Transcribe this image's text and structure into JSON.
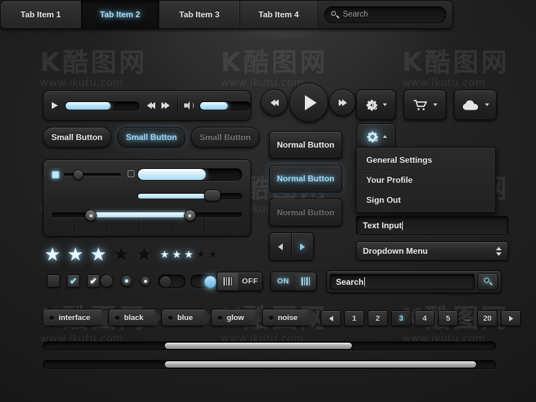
{
  "watermark": {
    "glyphs": "K酷图网",
    "url": "www.ikutu.com"
  },
  "tabbar": {
    "tabs": [
      {
        "label": "Tab Item 1",
        "active": false
      },
      {
        "label": "Tab Item 2",
        "active": true
      },
      {
        "label": "Tab Item 3",
        "active": false
      },
      {
        "label": "Tab Item 4",
        "active": false
      }
    ],
    "search_placeholder": "Search",
    "search_icon": "search-icon"
  },
  "player": {
    "play_icon": "play-icon",
    "progress_percent": 62,
    "prev_icon": "rewind-icon",
    "next_icon": "fast-forward-icon",
    "volume_icon": "speaker-icon",
    "volume_percent": 55
  },
  "transport": {
    "prev_icon": "rewind-icon",
    "play_icon": "play-icon",
    "next_icon": "fast-forward-icon"
  },
  "icon_buttons": [
    {
      "icon": "gear-icon",
      "name": "settings-dropdown-button"
    },
    {
      "icon": "cart-icon",
      "name": "cart-dropdown-button"
    },
    {
      "icon": "cloud-icon",
      "name": "cloud-dropdown-button"
    }
  ],
  "small_buttons": [
    {
      "label": "Small Button",
      "state": "default"
    },
    {
      "label": "Small Button",
      "state": "active"
    },
    {
      "label": "Small Button",
      "state": "disabled"
    }
  ],
  "normal_buttons": [
    {
      "label": "Normal Button",
      "state": "default"
    },
    {
      "label": "Normal Button",
      "state": "active"
    },
    {
      "label": "Normal Button",
      "state": "disabled"
    }
  ],
  "gear_menu": {
    "icon": "gear-icon",
    "items": [
      "General Settings",
      "Your Profile",
      "Sign Out"
    ]
  },
  "sliders": {
    "mini_value_percent": 16,
    "progress_value_percent": 65,
    "thin_value_percent": 72,
    "range_low_percent": 20,
    "range_high_percent": 72
  },
  "segmented": {
    "prev_icon": "left-arrow-icon",
    "next_icon": "right-arrow-icon",
    "active": "next"
  },
  "text_input": {
    "value": "Text Input"
  },
  "dropdown": {
    "value": "Dropdown Menu",
    "icon": "up-down-chevron-icon"
  },
  "stars": {
    "large": {
      "filled": 3,
      "total": 5,
      "glyph": "★"
    },
    "small": {
      "filled": 3,
      "total": 5,
      "glyph": "★"
    }
  },
  "checkboxes": [
    {
      "state": "unchecked",
      "mark": ""
    },
    {
      "state": "checked-blue",
      "mark": "✔"
    },
    {
      "state": "checked-white",
      "mark": "✔"
    }
  ],
  "radios": [
    {
      "state": "empty"
    },
    {
      "state": "selected-blue"
    },
    {
      "state": "selected-white"
    }
  ],
  "toggles": [
    {
      "state": "off"
    },
    {
      "state": "on"
    }
  ],
  "switches": [
    {
      "label": "OFF",
      "state": "off"
    },
    {
      "label": "ON",
      "state": "on"
    }
  ],
  "searchbox": {
    "value": "Search",
    "button_icon": "search-icon"
  },
  "tags": [
    "interface",
    "black",
    "blue",
    "glow",
    "noise"
  ],
  "pagination": {
    "prev_icon": "left-arrow-icon",
    "next_icon": "right-arrow-icon",
    "pages": [
      "1",
      "2",
      "3",
      "4",
      "5"
    ],
    "ellipsis": "...",
    "last": "20",
    "active": "3"
  },
  "scrollbars": [
    {
      "name": "horizontal-scrollbar-top"
    },
    {
      "name": "horizontal-scrollbar-bottom"
    }
  ],
  "colors": {
    "accent_blue": "#9fd7f3",
    "panel_dark": "#232323",
    "background": "#141414"
  }
}
